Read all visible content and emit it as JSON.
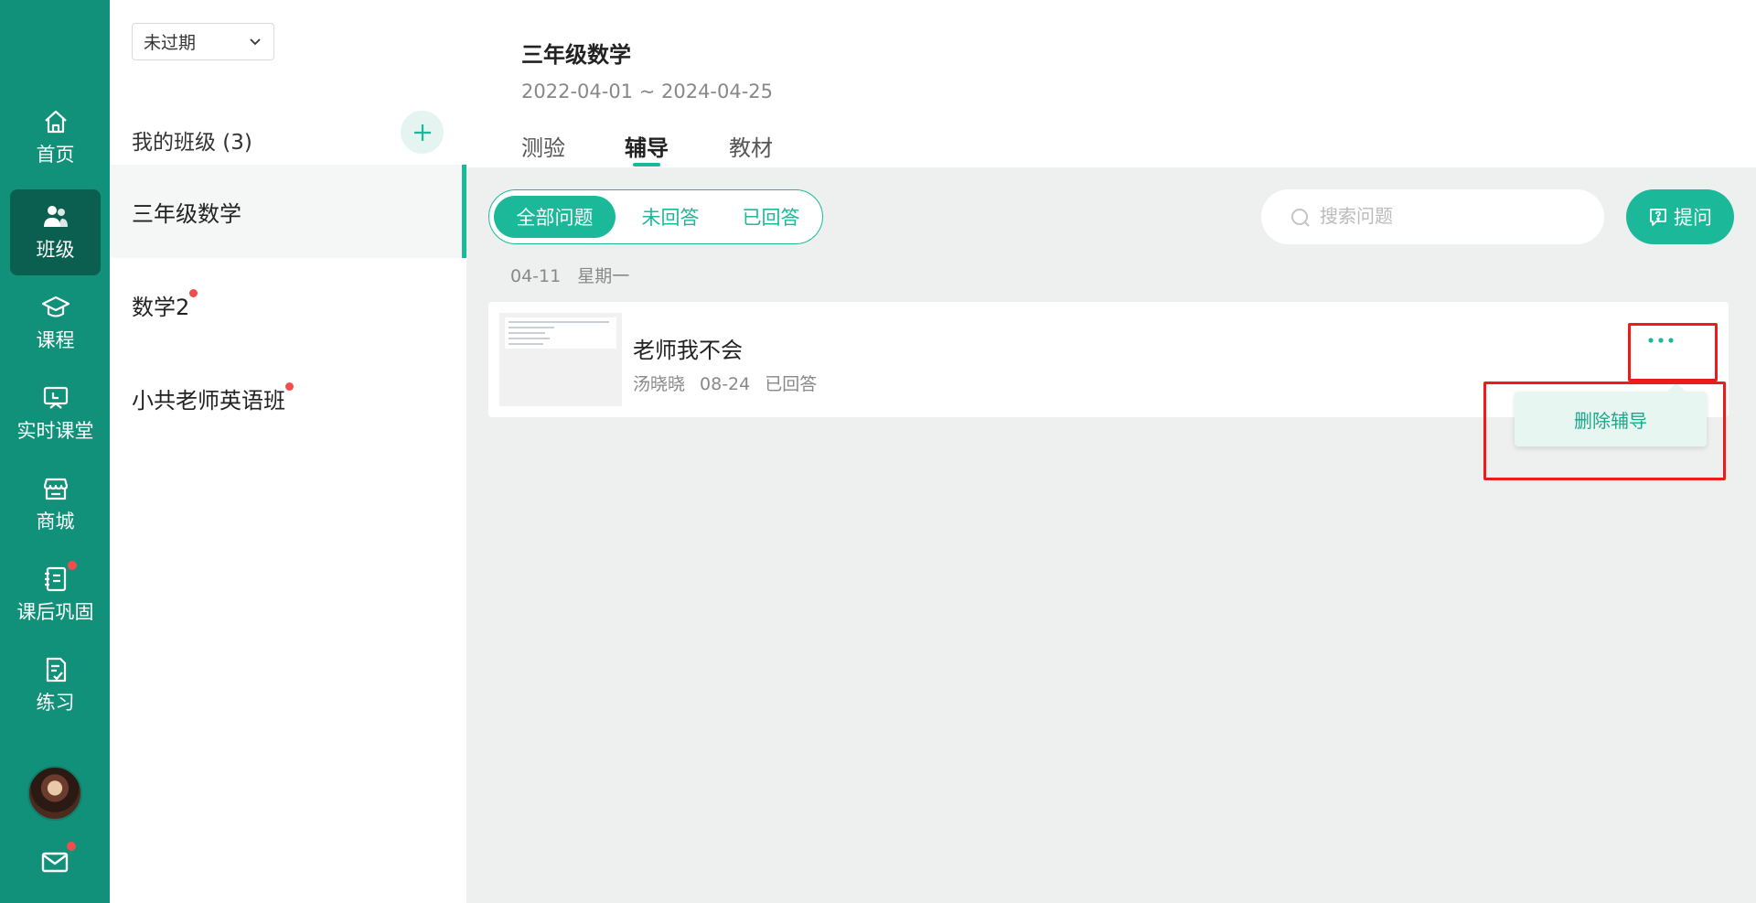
{
  "nav": {
    "items": [
      {
        "label": "首页",
        "icon": "home-icon"
      },
      {
        "label": "班级",
        "icon": "class-users-icon",
        "active": true
      },
      {
        "label": "课程",
        "icon": "graduation-cap-icon"
      },
      {
        "label": "实时课堂",
        "icon": "live-board-icon"
      },
      {
        "label": "商城",
        "icon": "store-icon"
      },
      {
        "label": "课后巩固",
        "icon": "notebook-icon",
        "badge": true
      },
      {
        "label": "练习",
        "icon": "checklist-icon"
      }
    ],
    "mail_badge": true
  },
  "classlist": {
    "filter_value": "未过期",
    "heading": "我的班级 (3)",
    "classes": [
      {
        "name": "三年级数学",
        "active": true,
        "badge": false
      },
      {
        "name": "数学2",
        "active": false,
        "badge": true
      },
      {
        "name": "小共老师英语班",
        "active": false,
        "badge": true
      }
    ]
  },
  "course": {
    "title": "三年级数学",
    "date_range": "2022-04-01 ~ 2024-04-25",
    "tabs": [
      "测验",
      "辅导",
      "教材"
    ],
    "active_tab": "辅导"
  },
  "filters": {
    "segments": [
      "全部问题",
      "未回答",
      "已回答"
    ],
    "active_segment": "全部问题",
    "search_placeholder": "搜索问题",
    "ask_label": "提问"
  },
  "questions": {
    "date": "04-11",
    "weekday": "星期一",
    "items": [
      {
        "title": "老师我不会",
        "author": "汤晓晓",
        "date": "08-24",
        "status": "已回答"
      }
    ]
  },
  "menu": {
    "delete_label": "删除辅导"
  },
  "colors": {
    "accent": "#1bb99a",
    "rail": "#11907a",
    "rail_active": "#0b5f51",
    "highlight": "#ee1b1b",
    "badge": "#f04e4e"
  }
}
